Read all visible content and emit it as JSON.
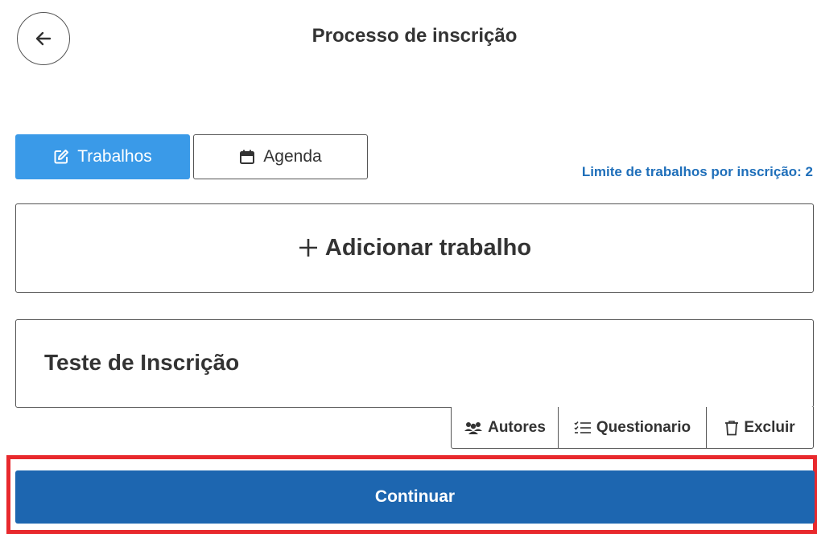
{
  "header": {
    "back_icon": "arrow-left-icon",
    "title": "Processo de inscrição"
  },
  "tabs": [
    {
      "label": "Trabalhos",
      "icon": "edit-icon",
      "active": true
    },
    {
      "label": "Agenda",
      "icon": "calendar-icon",
      "active": false
    }
  ],
  "limit_text": "Limite de trabalhos por inscrição: 2",
  "add_work": {
    "icon": "plus-icon",
    "label": "Adicionar trabalho"
  },
  "work_item": {
    "title": "Teste de Inscrição",
    "actions": [
      {
        "label": "Autores",
        "icon": "users-icon"
      },
      {
        "label": "Questionario",
        "icon": "checklist-icon"
      },
      {
        "label": "Excluir",
        "icon": "trash-icon"
      }
    ]
  },
  "continue_button": {
    "label": "Continuar"
  },
  "colors": {
    "active_tab": "#3a9ae8",
    "limit_text": "#1f6fba",
    "continue_button": "#1d66b0",
    "highlight": "#e8292d"
  }
}
